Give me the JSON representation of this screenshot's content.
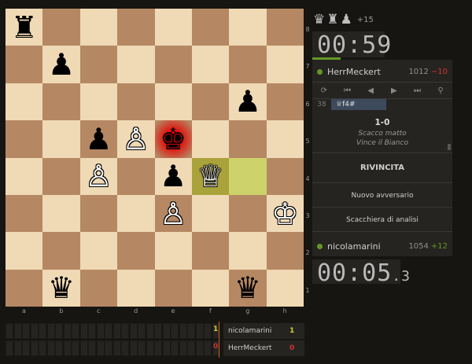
{
  "board": {
    "files": [
      "a",
      "b",
      "c",
      "d",
      "e",
      "f",
      "g",
      "h"
    ],
    "ranks": [
      "8",
      "7",
      "6",
      "5",
      "4",
      "3",
      "2",
      "1"
    ],
    "pieces": [
      {
        "square": "a8",
        "glyph": "♜",
        "color": "b",
        "name": "black-rook"
      },
      {
        "square": "b7",
        "glyph": "♟",
        "color": "b",
        "name": "black-pawn"
      },
      {
        "square": "g6",
        "glyph": "♟",
        "color": "b",
        "name": "black-pawn"
      },
      {
        "square": "c5",
        "glyph": "♟",
        "color": "b",
        "name": "black-pawn"
      },
      {
        "square": "d5",
        "glyph": "♙",
        "color": "w",
        "name": "white-pawn"
      },
      {
        "square": "e5",
        "glyph": "♚",
        "color": "b",
        "name": "black-king"
      },
      {
        "square": "c4",
        "glyph": "♙",
        "color": "w",
        "name": "white-pawn"
      },
      {
        "square": "e4",
        "glyph": "♟",
        "color": "b",
        "name": "black-pawn"
      },
      {
        "square": "f4",
        "glyph": "♕",
        "color": "w",
        "name": "white-queen"
      },
      {
        "square": "e3",
        "glyph": "♙",
        "color": "w",
        "name": "white-pawn"
      },
      {
        "square": "h3",
        "glyph": "♔",
        "color": "w",
        "name": "white-king"
      },
      {
        "square": "b1",
        "glyph": "♛",
        "color": "b",
        "name": "black-queen"
      },
      {
        "square": "g1",
        "glyph": "♛",
        "color": "b",
        "name": "black-queen"
      }
    ],
    "last_move": [
      "f4",
      "g4"
    ],
    "check_square": "e5"
  },
  "captured": {
    "pieces": [
      "♛",
      "♜",
      "♟"
    ],
    "advantage": "+15"
  },
  "clock_top": {
    "time": "00:59"
  },
  "clock_bottom": {
    "time": "00:05",
    "tenths": ".3"
  },
  "top_player": {
    "name": "HerrMeckert",
    "rating": "1012",
    "diff": "−10"
  },
  "bottom_player": {
    "name": "nicolamarini",
    "rating": "1054",
    "diff": "+12"
  },
  "controls": [
    "⟳",
    "⏮",
    "◀",
    "▶",
    "⏭",
    "⚲"
  ],
  "moves": {
    "number": "38",
    "move": "♕f4#"
  },
  "result": {
    "score": "1-0",
    "line1": "Scacco matto",
    "line2": "Vince il Bianco"
  },
  "buttons": {
    "rematch": "RIVINCITA",
    "new_opponent": "Nuovo avversario",
    "analysis": "Scacchiera di analisi"
  },
  "crosstable": [
    {
      "name": "nicolamarini",
      "points": "1",
      "left": "1"
    },
    {
      "name": "HerrMeckert",
      "points": "0",
      "left": "0"
    }
  ],
  "colors": {
    "light": "#f0d9b5",
    "dark": "#b58863",
    "accent": "#629924",
    "loss": "#cc3333"
  }
}
